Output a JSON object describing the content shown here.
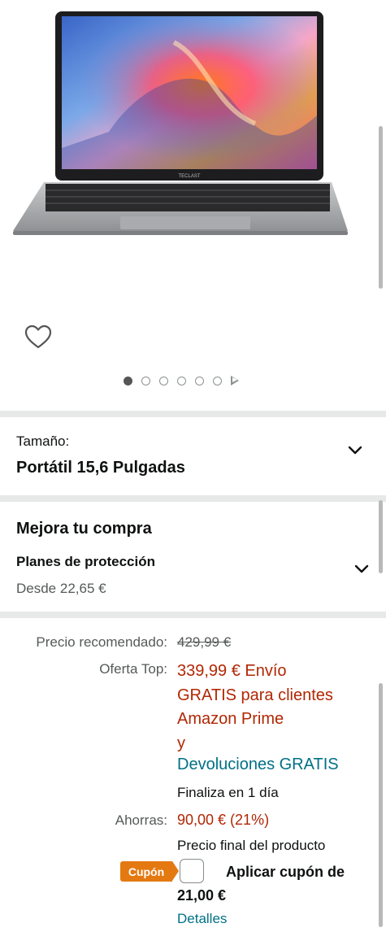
{
  "gallery": {
    "brand_on_screen": "TECLAST",
    "dots_count": 6,
    "active_dot": 0,
    "wishlist_icon": "heart-outline-icon",
    "video_icon": "play-triangle-icon"
  },
  "size": {
    "label": "Tamaño:",
    "value": "Portátil 15,6 Pulgadas"
  },
  "upgrade": {
    "title": "Mejora tu compra",
    "plans_label": "Planes de protección",
    "plans_price": "Desde 22,65 €"
  },
  "price": {
    "recommended_label": "Precio recomendado:",
    "recommended_value": "429,99 €",
    "offer_label": "Oferta Top:",
    "offer_line1": "339,99 € Envío",
    "offer_line2": "GRATIS para clientes",
    "offer_line3": "Amazon Prime",
    "offer_line4": "y",
    "returns_link": "Devoluciones GRATIS",
    "ends": "Finaliza en 1 día",
    "savings_label": "Ahorras:",
    "savings_value": "90,00 € (21%)",
    "final_note": "Precio final del producto"
  },
  "coupon": {
    "badge": "Cupón",
    "apply_line1": "Aplicar cupón de",
    "apply_line2": "21,00 €",
    "details_link": "Detalles"
  },
  "colors": {
    "price_red": "#b12704",
    "link_teal": "#007185",
    "coupon_orange": "#e47911"
  }
}
